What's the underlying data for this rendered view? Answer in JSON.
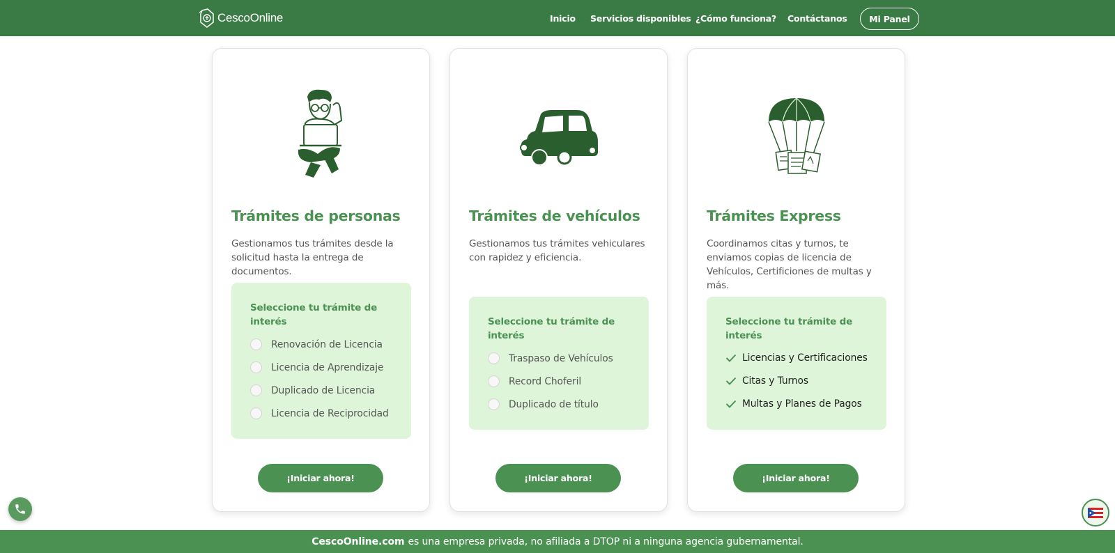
{
  "header": {
    "brand_bold": "Cesco",
    "brand_light": "Online",
    "nav": [
      "Inicio",
      "Servicios disponibles",
      "¿Cómo funciona?",
      "Contáctanos"
    ],
    "panel_button": "Mi Panel"
  },
  "cards": [
    {
      "illustration": "person-with-laptop-icon",
      "title": "Trámites de personas",
      "description": "Gestionamos tus trámites desde la solicitud hasta la entrega de documentos.",
      "options_heading": "Seleccione tu trámite de interés",
      "options": [
        "Renovación de Licencia",
        "Licencia de Aprendizaje",
        "Duplicado de Licencia",
        "Licencia de Reciprocidad"
      ],
      "button": "¡Iniciar ahora!"
    },
    {
      "illustration": "car-icon",
      "title": "Trámites de vehículos",
      "description": "Gestionamos tus trámites vehiculares con rapidez y eficiencia.",
      "options_heading": "Seleccione tu trámite de interés",
      "options": [
        "Traspaso de Vehículos",
        "Record Choferil",
        "Duplicado de título"
      ],
      "button": "¡Iniciar ahora!"
    },
    {
      "illustration": "parachute-documents-icon",
      "title": "Trámites Express",
      "description": "Coordinamos citas y turnos, te enviamos copias de licencia de Vehículos, Certificiones de multas y más.",
      "options_heading": "Seleccione tu trámite de interés",
      "options": [
        "Licencias y Certificaciones",
        "Citas y Turnos",
        "Multas y Planes de Pagos"
      ],
      "button": "¡Iniciar ahora!"
    }
  ],
  "footer": {
    "brand": "CescoOnline.com",
    "text": "es una empresa privada, no afiliada a DTOP ni a ninguna agencia gubernamental."
  },
  "floating": {
    "phone_icon": "phone-icon",
    "flag_icon": "puerto-rico-flag-icon"
  },
  "colors": {
    "nav_green": "#3a7a44",
    "primary_green": "#4a9152",
    "options_bg": "#dff5da"
  }
}
